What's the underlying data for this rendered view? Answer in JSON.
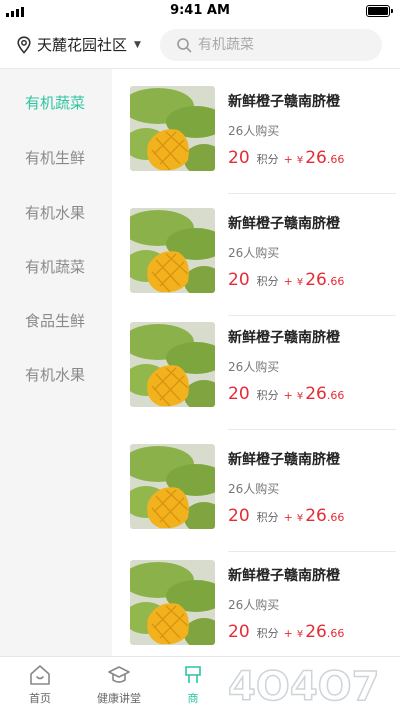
{
  "status_bar": {
    "time": "9:41 AM"
  },
  "header": {
    "location": "天麓花园社区",
    "search_placeholder": "有机蔬菜"
  },
  "sidebar": {
    "categories": [
      {
        "label": "有机蔬菜",
        "active": true
      },
      {
        "label": "有机生鲜",
        "active": false
      },
      {
        "label": "有机水果",
        "active": false
      },
      {
        "label": "有机蔬菜",
        "active": false
      },
      {
        "label": "食品生鲜",
        "active": false
      },
      {
        "label": "有机水果",
        "active": false
      }
    ]
  },
  "products": [
    {
      "name": "新鲜橙子赣南脐橙",
      "sold": "26人购买",
      "points": "20",
      "points_label": "积分",
      "plus": "+",
      "currency": "¥",
      "price_int": "26",
      "price_dec": ".66"
    },
    {
      "name": "新鲜橙子赣南脐橙",
      "sold": "26人购买",
      "points": "20",
      "points_label": "积分",
      "plus": "+",
      "currency": "¥",
      "price_int": "26",
      "price_dec": ".66"
    },
    {
      "name": "新鲜橙子赣南脐橙",
      "sold": "26人购买",
      "points": "20",
      "points_label": "积分",
      "plus": "+",
      "currency": "¥",
      "price_int": "26",
      "price_dec": ".66"
    },
    {
      "name": "新鲜橙子赣南脐橙",
      "sold": "26人购买",
      "points": "20",
      "points_label": "积分",
      "plus": "+",
      "currency": "¥",
      "price_int": "26",
      "price_dec": ".66"
    },
    {
      "name": "新鲜橙子赣南脐橙",
      "sold": "26人购买",
      "points": "20",
      "points_label": "积分",
      "plus": "+",
      "currency": "¥",
      "price_int": "26",
      "price_dec": ".66"
    }
  ],
  "tab_bar": {
    "tabs": [
      {
        "label": "首页",
        "icon": "home-icon",
        "active": false
      },
      {
        "label": "健康讲堂",
        "icon": "graduation-cap-icon",
        "active": false
      },
      {
        "label": "商",
        "icon": "shop-icon",
        "active": true
      }
    ]
  },
  "watermark": "4O4O7",
  "colors": {
    "accent": "#2dc4a0",
    "price": "#e52c36",
    "sidebar_bg": "#f5f5f5"
  }
}
